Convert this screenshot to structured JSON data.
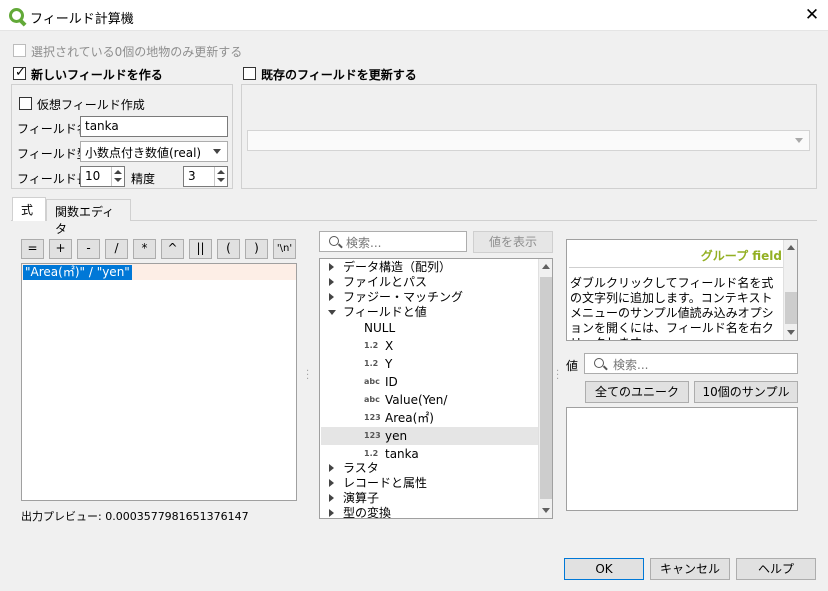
{
  "window": {
    "title": "フィールド計算機"
  },
  "top": {
    "only_selected_label": "選択されている0個の地物のみ更新する",
    "new_field_label": "新しいフィールドを作る",
    "update_existing_label": "既存のフィールドを更新する",
    "virtual_field_label": "仮想フィールド作成",
    "field_name_label": "フィールド名",
    "field_name_value": "tanka",
    "field_type_label": "フィールド型",
    "field_type_value": "小数点付き数値(real)",
    "field_length_label": "フィールド長",
    "field_length_value": "10",
    "precision_label": "精度",
    "precision_value": "3"
  },
  "tabs": [
    {
      "label": "式"
    },
    {
      "label": "関数エディタ"
    }
  ],
  "operators": [
    "=",
    "+",
    "-",
    "/",
    "*",
    "^",
    "||",
    "(",
    ")",
    "'\\n'"
  ],
  "expression": "\"Area(㎡)\" / \"yen\"",
  "preview": "出力プレビュー: 0.0003577981651376147",
  "search": {
    "placeholder": "検索...",
    "show_values_label": "値を表示"
  },
  "tree": {
    "groups_top": [
      "データ構造（配列）",
      "ファイルとパス",
      "ファジー・マッチング"
    ],
    "open_group": "フィールドと値",
    "fields": [
      {
        "type": "",
        "name": "NULL"
      },
      {
        "type": "1.2",
        "name": "X"
      },
      {
        "type": "1.2",
        "name": "Y"
      },
      {
        "type": "abc",
        "name": "ID"
      },
      {
        "type": "abc",
        "name": "Value(Yen/"
      },
      {
        "type": "123",
        "name": "Area(㎡)"
      },
      {
        "type": "123",
        "name": "yen"
      },
      {
        "type": "1.2",
        "name": "tanka"
      }
    ],
    "groups_bottom": [
      "ラスタ",
      "レコードと属性",
      "演算子",
      "型の変換"
    ]
  },
  "help": {
    "title": "グループ field",
    "text": "ダブルクリックしてフィールド名を式の文字列に追加します。コンテキストメニューのサンプル値読み込みオプションを開くには、フィールド名を右クリックします。"
  },
  "values": {
    "label": "値",
    "search_placeholder": "検索...",
    "all_unique_label": "全てのユニーク",
    "sample_label": "10個のサンプル"
  },
  "footer": {
    "ok": "OK",
    "cancel": "キャンセル",
    "help": "ヘルプ"
  },
  "colors": {
    "selection": "#0078d7",
    "help_title": "#93b023",
    "qgis_green": "#62a938"
  }
}
